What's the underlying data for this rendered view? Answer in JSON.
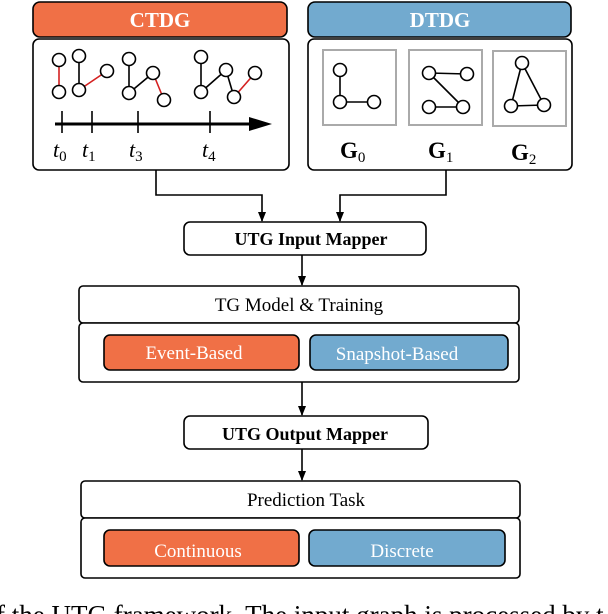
{
  "ctdg": {
    "title": "CTDG",
    "time_labels": [
      "t",
      "t",
      "t",
      "t"
    ],
    "time_subscripts": [
      "0",
      "1",
      "3",
      "4"
    ],
    "color": "#F07046"
  },
  "dtdg": {
    "title": "DTDG",
    "snapshots": [
      "G",
      "G",
      "G"
    ],
    "snapshot_subscripts": [
      "0",
      "1",
      "2"
    ],
    "color": "#72AACF"
  },
  "input_mapper": "UTG Input Mapper",
  "model": {
    "title": "TG Model & Training",
    "options": [
      "Event-Based",
      "Snapshot-Based"
    ]
  },
  "output_mapper": "UTG Output Mapper",
  "prediction": {
    "title": "Prediction Task",
    "options": [
      "Continuous",
      "Discrete"
    ]
  },
  "caption": "f the UTG framework. The input graph is processed by t"
}
